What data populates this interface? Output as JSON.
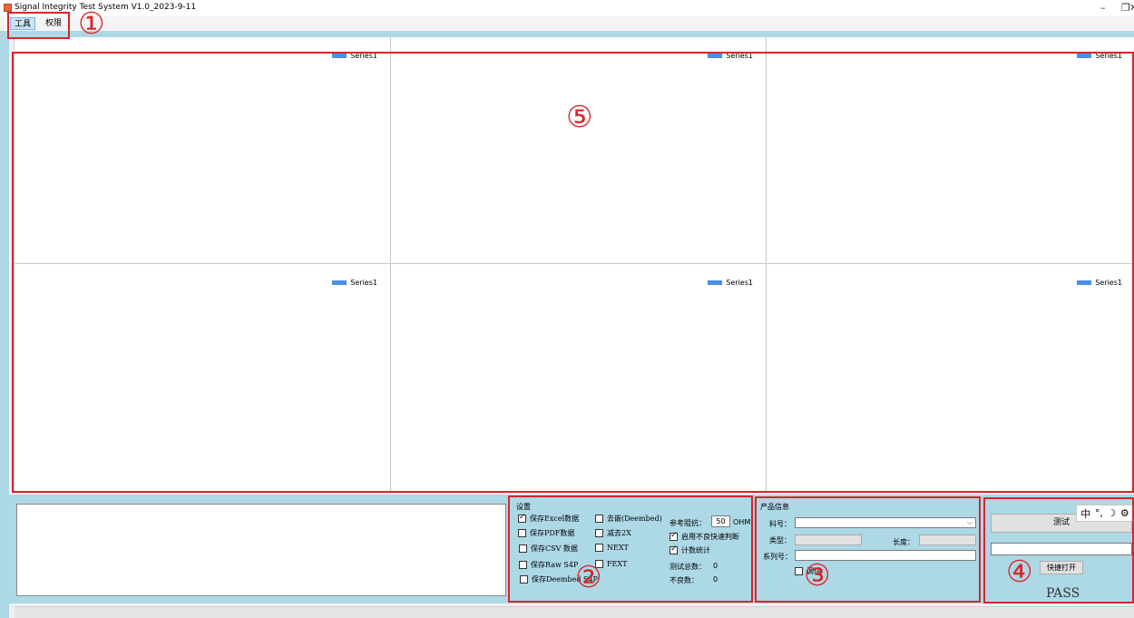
{
  "window": {
    "title": "Signal Integrity Test System V1.0_2023-9-11",
    "controls": {
      "minimize": "–",
      "restore": "❐",
      "close": "✕"
    }
  },
  "menu": {
    "tools": "工具",
    "permissions": "权限"
  },
  "charts": {
    "legend_label": "Series1",
    "legend_color": "#4a8fe8",
    "count": 6
  },
  "settings": {
    "title": "设置",
    "items": [
      {
        "label": "保存Excel数据",
        "checked": true
      },
      {
        "label": "保存PDF数据",
        "checked": false
      },
      {
        "label": "保存CSV 数据",
        "checked": false
      },
      {
        "label": "保存Raw S4P",
        "checked": false
      },
      {
        "label": "保存Deembed S4P",
        "checked": false
      },
      {
        "label": "去嵌(Deembed)",
        "checked": false
      },
      {
        "label": "减去2X",
        "checked": false
      },
      {
        "label": "NEXT",
        "checked": false
      },
      {
        "label": "FEXT",
        "checked": false
      }
    ],
    "impedance_label": "参考阻抗：",
    "impedance_value": "50",
    "impedance_unit": "OHM",
    "enable_fast_fail": "启用不良快速判断",
    "count_stats": "计数统计",
    "total_label": "测试总数：",
    "total_value": "0",
    "fail_label": "不良数：",
    "fail_value": "0"
  },
  "product": {
    "title": "产品信息",
    "part_no_label": "料号：",
    "type_label": "类型：",
    "length_label": "长度：",
    "serial_label": "系列号：",
    "debug_label": "调试"
  },
  "actions": {
    "test_button": "测试",
    "quick_open": "快捷打开",
    "result": "PASS",
    "ime": {
      "chinese": "中",
      "punct": "°,",
      "moon": "☽",
      "gear": "⚙"
    }
  },
  "annotations": {
    "color": "#d9262a",
    "labels": [
      "①",
      "②",
      "③",
      "④",
      "⑤"
    ]
  }
}
